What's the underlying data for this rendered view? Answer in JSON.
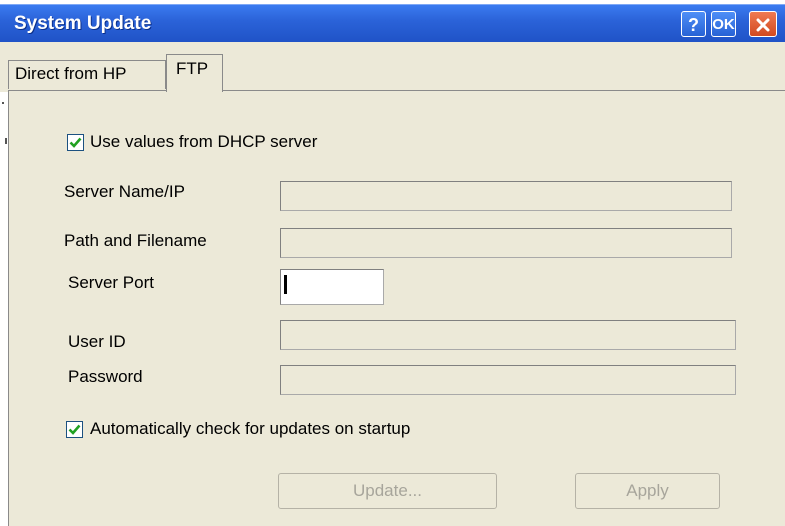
{
  "window": {
    "title": "System Update",
    "help_label": "?",
    "ok_label": "OK"
  },
  "tabs": [
    {
      "label": "Direct from HP",
      "selected": false
    },
    {
      "label": "FTP",
      "selected": true
    }
  ],
  "form": {
    "dhcp_checkbox": {
      "label": "Use values from DHCP server",
      "checked": true
    },
    "server_name": {
      "label": "Server Name/IP",
      "value": ""
    },
    "path_filename": {
      "label": "Path and Filename",
      "value": ""
    },
    "server_port": {
      "label": "Server Port",
      "value": ""
    },
    "user_id": {
      "label": "User ID",
      "value": ""
    },
    "password": {
      "label": "Password",
      "value": ""
    },
    "auto_check": {
      "label": "Automatically check for updates on startup",
      "checked": true
    }
  },
  "buttons": {
    "update_label": "Update...",
    "apply_label": "Apply"
  },
  "colors": {
    "titlebar": "#2b63d9",
    "dialog_bg": "#ece9d8",
    "check_green": "#21a121"
  }
}
